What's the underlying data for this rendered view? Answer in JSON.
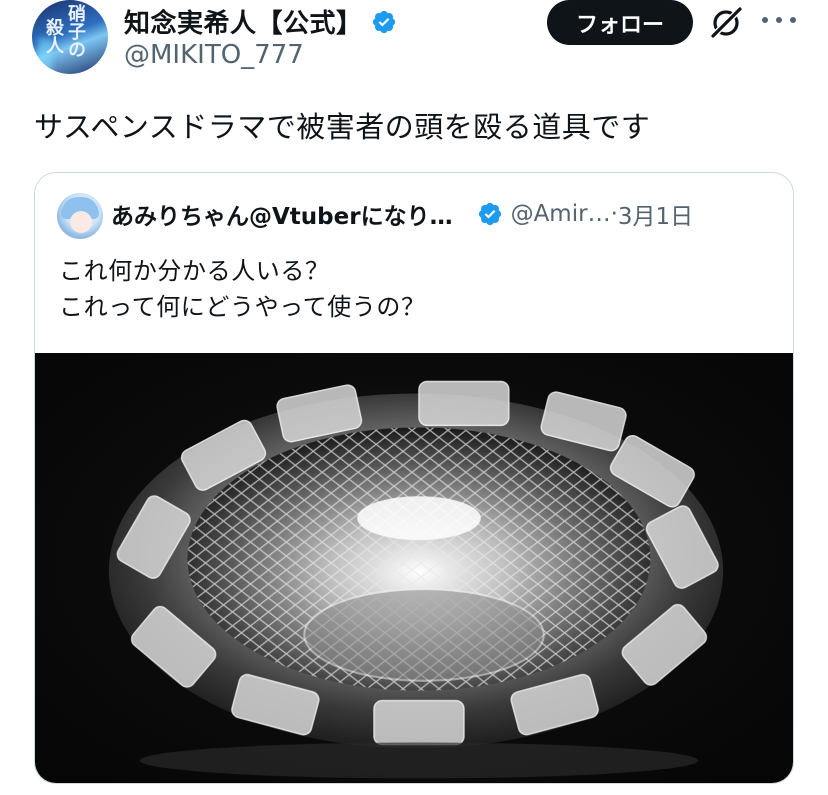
{
  "author": {
    "avatar_text_1": "硝子の",
    "avatar_text_2": "殺人",
    "display_name": "知念実希人【公式】",
    "handle": "@MIKITO_777"
  },
  "actions": {
    "follow_label": "フォロー",
    "grok_icon": "grok-icon",
    "more_icon": "more-dots-icon"
  },
  "tweet": {
    "text": "サスペンスドラマで被害者の頭を殴る道具です"
  },
  "quote": {
    "display_name": "あみりちゃん@Vtuberになり…",
    "handle": "@Amir…",
    "separator": " · ",
    "date": "3月1日",
    "lines": [
      "これ何か分かる人いる？",
      "これって何にどうやって使うの？"
    ],
    "image": "crystal-glass-ashtray"
  },
  "colors": {
    "verified": "#1d9bf0",
    "follow_bg": "#0f1419",
    "muted": "#536471",
    "border": "#cfd9de"
  }
}
